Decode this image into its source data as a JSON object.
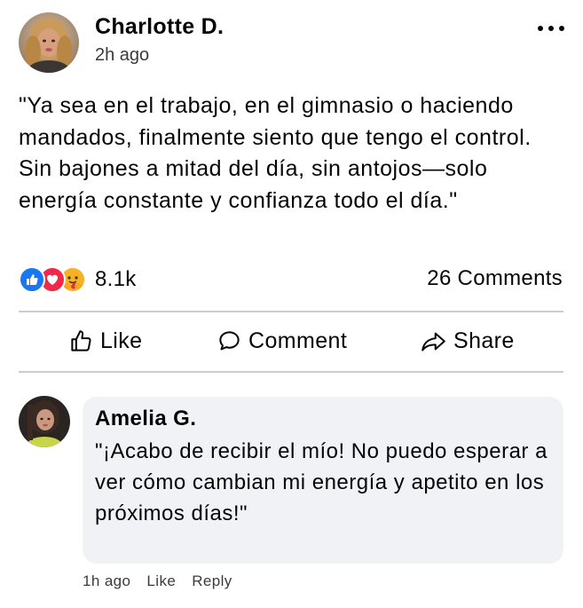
{
  "post": {
    "author": "Charlotte D.",
    "timestamp": "2h ago",
    "body": "\"Ya sea en el trabajo, en el gimnasio o haciendo mandados, finalmente siento que tengo el control. Sin bajones a mitad del día, sin antojos—solo energía constante y confianza todo el día.\""
  },
  "reactions": {
    "icons": [
      "like-icon",
      "love-icon",
      "care-icon"
    ],
    "count": "8.1k"
  },
  "comments_count": "26 Comments",
  "actions": {
    "like": "Like",
    "comment": "Comment",
    "share": "Share"
  },
  "comment": {
    "author": "Amelia G.",
    "text": "\"¡Acabo de recibir el mío! No puedo esperar a ver cómo cambian mi energía y apetito en los próximos días!\"",
    "time": "1h ago",
    "like": "Like",
    "reply": "Reply"
  },
  "colors": {
    "like_blue": "#1877f2",
    "love_red": "#f02849",
    "care_yellow": "#f7b125",
    "bubble_bg": "#f0f2f5",
    "divider": "#c9ccd1"
  }
}
